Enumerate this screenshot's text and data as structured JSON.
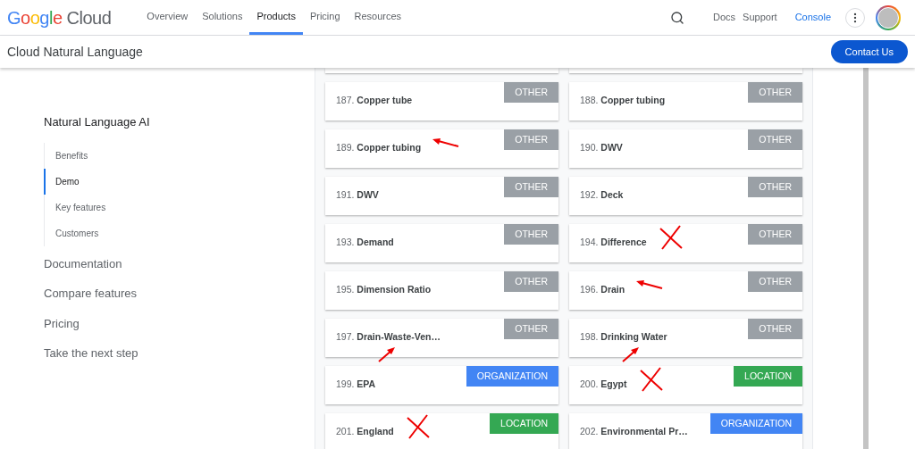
{
  "header": {
    "logo": "Google Cloud",
    "nav": [
      {
        "label": "Overview",
        "selected": false
      },
      {
        "label": "Solutions",
        "selected": false
      },
      {
        "label": "Products",
        "selected": true
      },
      {
        "label": "Pricing",
        "selected": false
      },
      {
        "label": "Resources",
        "selected": false
      }
    ],
    "links": [
      "Docs",
      "Support"
    ],
    "console": "Console"
  },
  "subheader": {
    "title": "Cloud Natural Language",
    "button": "Contact Us"
  },
  "sidebar": {
    "title": "Natural Language AI",
    "items": [
      {
        "label": "Benefits",
        "selected": false
      },
      {
        "label": "Demo",
        "selected": true
      },
      {
        "label": "Key features",
        "selected": false
      },
      {
        "label": "Customers",
        "selected": false
      }
    ],
    "sections": [
      "Documentation",
      "Compare features",
      "Pricing",
      "Take the next step"
    ]
  },
  "entities": [
    {
      "kind": "plain",
      "number": "187.",
      "name": "Copper tube",
      "tag": "OTHER",
      "color": "#9aa0a6"
    },
    {
      "kind": "plain",
      "number": "188.",
      "name": "Copper tubing",
      "tag": "OTHER",
      "color": "#9aa0a6"
    },
    {
      "kind": "arrowleft",
      "number": "189.",
      "name": "Copper tubing",
      "tag": "OTHER",
      "color": "#9aa0a6"
    },
    {
      "kind": "plain",
      "number": "190.",
      "name": "DWV",
      "tag": "OTHER",
      "color": "#9aa0a6"
    },
    {
      "kind": "plain",
      "number": "191.",
      "name": "DWV",
      "tag": "OTHER",
      "color": "#9aa0a6"
    },
    {
      "kind": "plain",
      "number": "192.",
      "name": "Deck",
      "tag": "OTHER",
      "color": "#9aa0a6"
    },
    {
      "kind": "plain",
      "number": "193.",
      "name": "Demand",
      "tag": "OTHER",
      "color": "#9aa0a6"
    },
    {
      "kind": "crossed",
      "number": "194.",
      "name": "Difference",
      "tag": "OTHER",
      "color": "#9aa0a6"
    },
    {
      "kind": "plain",
      "number": "195.",
      "name": "Dimension Ratio",
      "tag": "OTHER",
      "color": "#9aa0a6"
    },
    {
      "kind": "arrowleft",
      "number": "196.",
      "name": "Drain",
      "tag": "OTHER",
      "color": "#9aa0a6"
    },
    {
      "kind": "arrowup",
      "number": "197.",
      "name": "Drain-Waste-Ven…",
      "tag": "OTHER",
      "color": "#9aa0a6"
    },
    {
      "kind": "arrowup",
      "number": "198.",
      "name": "Drinking Water",
      "tag": "OTHER",
      "color": "#9aa0a6"
    },
    {
      "kind": "plain",
      "number": "199.",
      "name": "EPA",
      "tag": "ORGANIZATION",
      "color": "#4285f4"
    },
    {
      "kind": "crossed",
      "number": "200.",
      "name": "Egypt",
      "tag": "LOCATION",
      "color": "#34a853"
    },
    {
      "kind": "crossed",
      "number": "201.",
      "name": "England",
      "tag": "LOCATION",
      "color": "#34a853"
    },
    {
      "kind": "plain",
      "number": "202.",
      "name": "Environmental Pr…",
      "tag": "ORGANIZATION",
      "color": "#4285f4"
    }
  ]
}
